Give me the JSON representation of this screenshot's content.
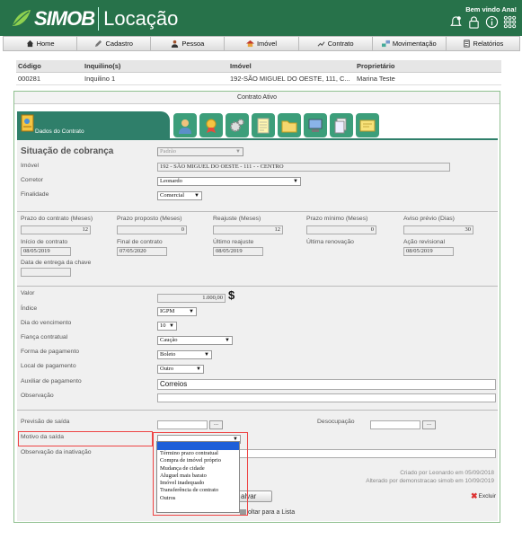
{
  "header": {
    "brand": "SIMOB",
    "product": "Locação",
    "welcome": "Bem vindo Ana!",
    "icons": [
      "bell-icon",
      "lock-icon",
      "info-icon",
      "apps-icon"
    ]
  },
  "nav": [
    {
      "label": "Home",
      "icon": "home-icon"
    },
    {
      "label": "Cadastro",
      "icon": "pen-icon"
    },
    {
      "label": "Pessoa",
      "icon": "person-icon"
    },
    {
      "label": "Imóvel",
      "icon": "house-icon"
    },
    {
      "label": "Contrato",
      "icon": "contract-icon"
    },
    {
      "label": "Movimentação",
      "icon": "transfer-icon"
    },
    {
      "label": "Relatórios",
      "icon": "report-icon"
    }
  ],
  "summary": {
    "headers": [
      "Código",
      "Inquilino(s)",
      "Imóvel",
      "Proprietário"
    ],
    "row": [
      "000281",
      "Inquilino 1",
      "192-SÃO MIGUEL DO OESTE, 111, C...",
      "Marina Teste"
    ]
  },
  "panel": {
    "title": "Contrato Ativo",
    "active_tab": "Dados do Contrato",
    "tab_icons": [
      "tenant-icon",
      "medal-icon",
      "gears-icon",
      "notes-icon",
      "folder-icon",
      "computer-icon",
      "documents-icon",
      "note-icon"
    ]
  },
  "form": {
    "situacao_label": "Situação de cobrança",
    "situacao_value": "Padrão",
    "imovel_label": "Imóvel",
    "imovel_value": "192 - SÃO MIGUEL DO OESTE - 111 - - CENTRO",
    "corretor_label": "Corretor",
    "corretor_value": "Leonardo",
    "finalidade_label": "Finalidade",
    "finalidade_value": "Comercial",
    "prazo_contrato_label": "Prazo do contrato (Meses)",
    "prazo_contrato_value": "12",
    "prazo_proposto_label": "Prazo proposto (Meses)",
    "prazo_proposto_value": "0",
    "reajuste_label": "Reajuste (Meses)",
    "reajuste_value": "12",
    "prazo_minimo_label": "Prazo mínimo (Meses)",
    "prazo_minimo_value": "0",
    "aviso_label": "Aviso prévio (Dias)",
    "aviso_value": "30",
    "inicio_label": "Início de contrato",
    "inicio_value": "08/05/2019",
    "final_label": "Final de contrato",
    "final_value": "07/05/2020",
    "ultimo_reajuste_label": "Último reajuste",
    "ultimo_reajuste_value": "08/05/2019",
    "ultima_renovacao_label": "Última renovação",
    "acao_label": "Ação revisional",
    "acao_value": "08/05/2019",
    "entrega_label": "Data de entrega da chave",
    "valor_label": "Valor",
    "valor_value": "1.000,00",
    "currency": "$",
    "indice_label": "Índice",
    "indice_value": "IGPM",
    "dia_label": "Dia do vencimento",
    "dia_value": "10",
    "fianca_label": "Fiança contratual",
    "fianca_value": "Caução",
    "forma_label": "Forma de pagamento",
    "forma_value": "Boleto",
    "local_label": "Local de pagamento",
    "local_value": "Outro",
    "auxiliar_label": "Auxiliar de pagamento",
    "auxiliar_value": "Correios",
    "observacao_label": "Observação",
    "previsao_label": "Previsão de saída",
    "desocupacao_label": "Desocupação",
    "dots": "...",
    "motivo_label": "Motivo da saída",
    "obs_inativacao_label": "Observação da inativação",
    "criado": "Criado por Leonardo em 05/09/2018",
    "alterado": "Alterado por demonstracao simob em 10/09/2019",
    "salvar": "alvar",
    "excluir": "Excluir",
    "voltar": "oltar para a Lista",
    "motivo_options": [
      "Término prazo contratual",
      "Compra de imóvel próprio",
      "Mudança de cidade",
      "Aluguel mais barato",
      "Imóvel inadequado",
      "Transferência de contrato",
      "Outros"
    ]
  },
  "colors": {
    "brand_green": "#27724a",
    "tab_teal": "#2f7f6a",
    "highlight_blue": "#1e5fd8",
    "red_outline": "#e44444"
  }
}
